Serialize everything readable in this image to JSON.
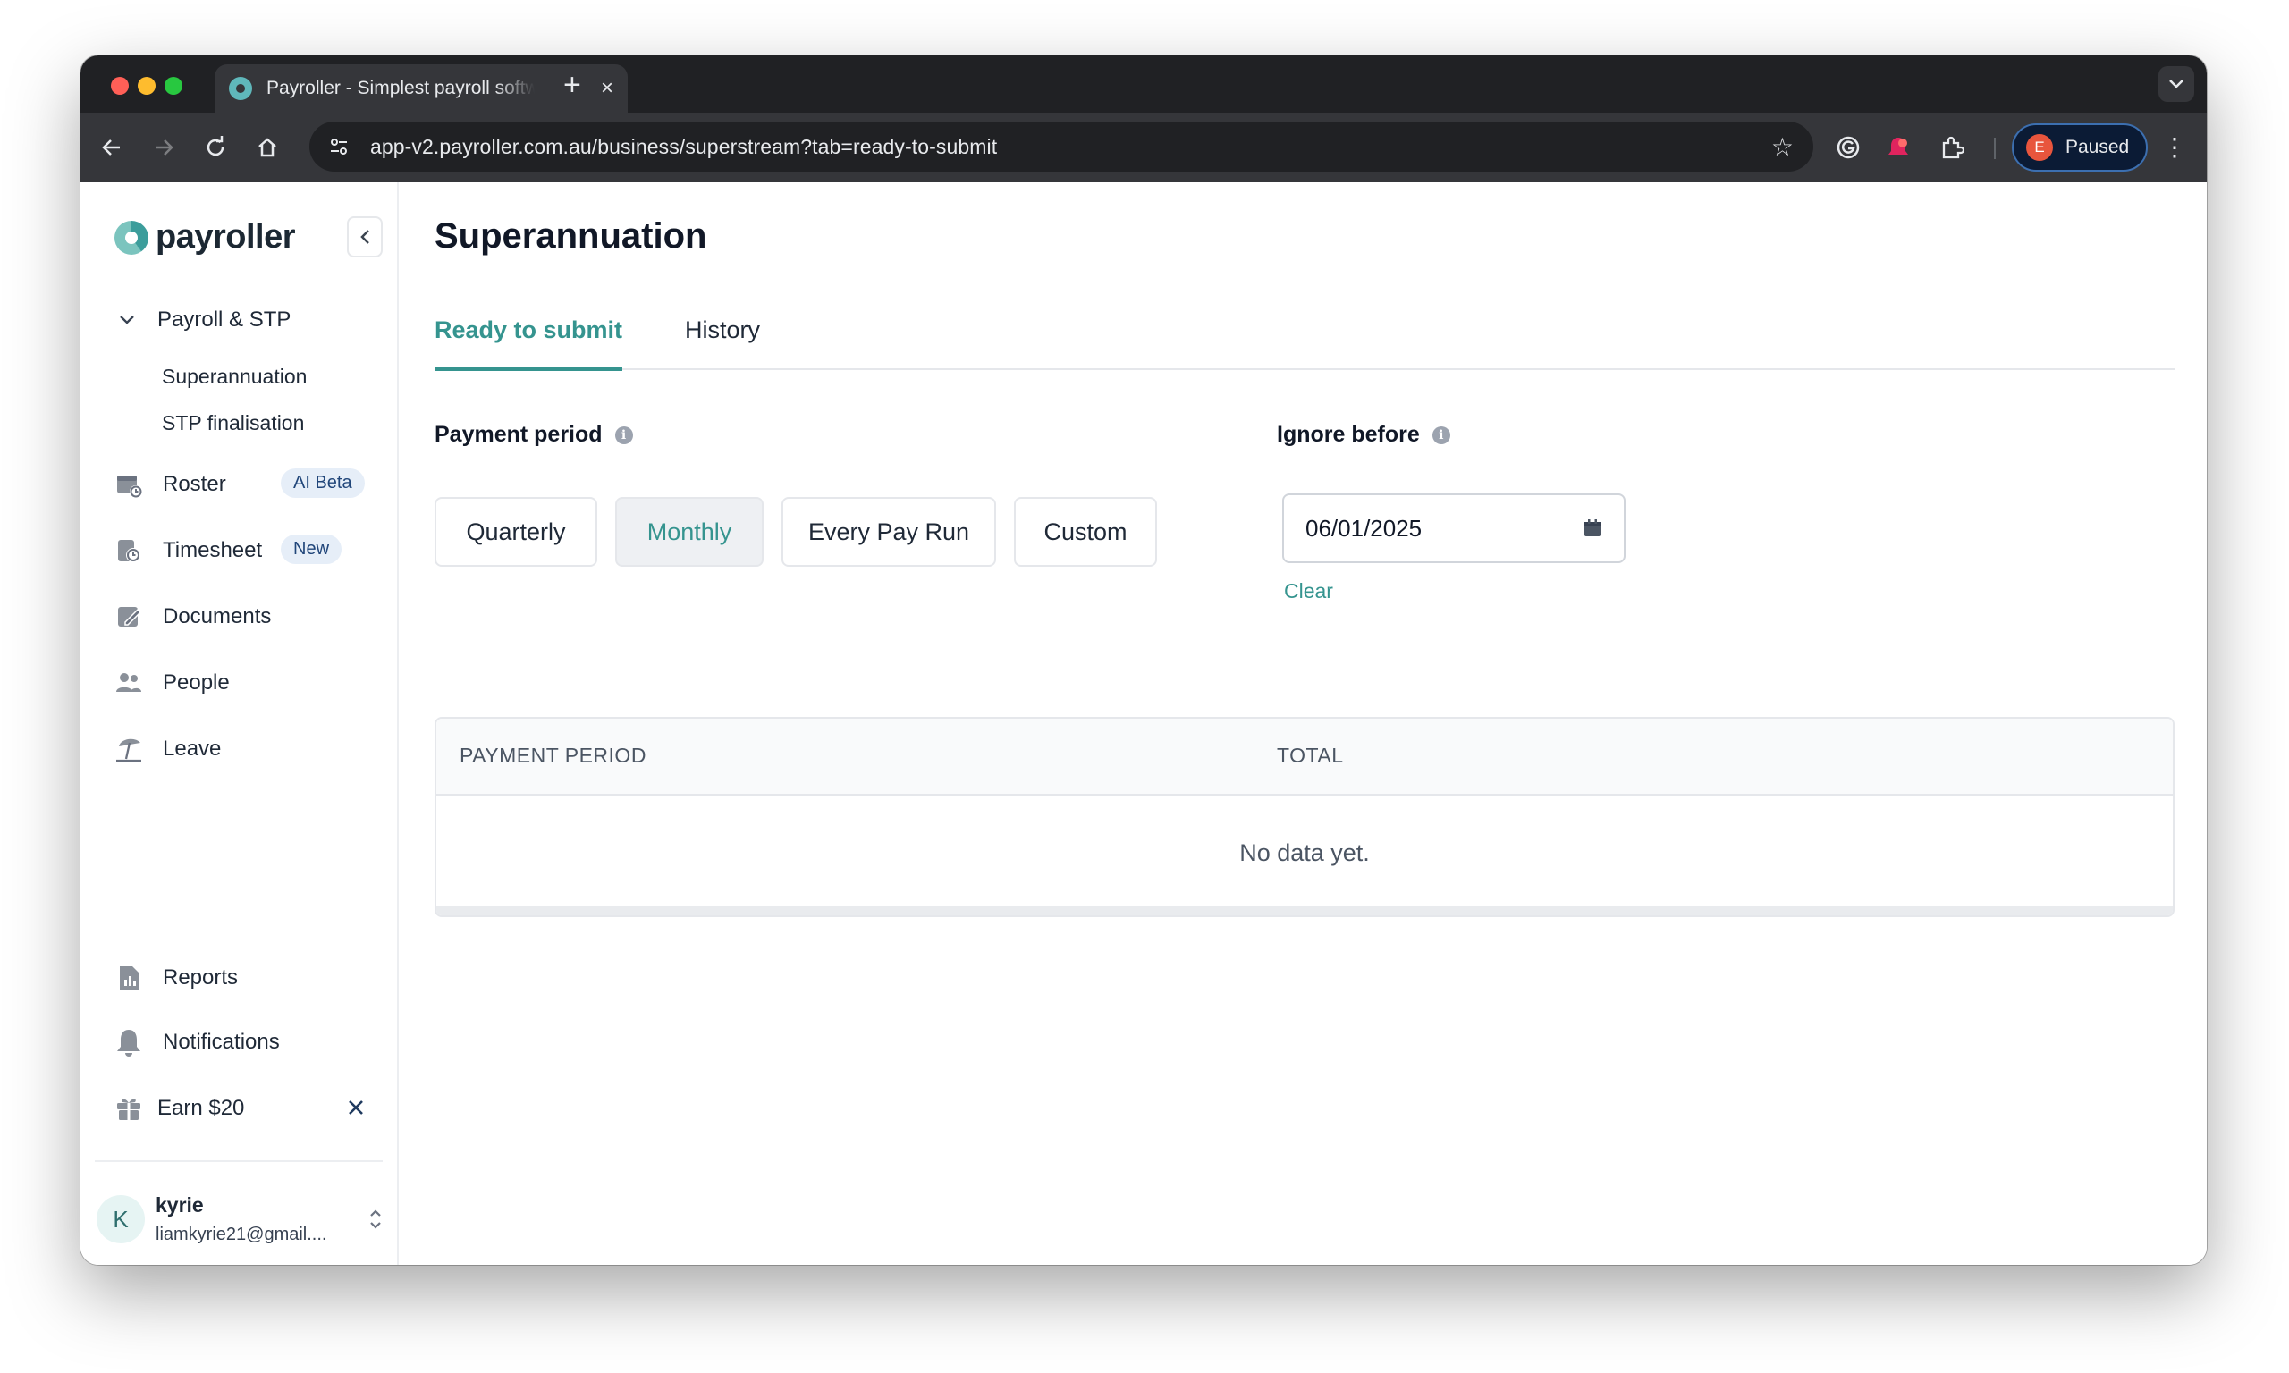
{
  "browser": {
    "tab_title": "Payroller - Simplest payroll software",
    "tab_close": "×",
    "new_tab": "+",
    "url": "app-v2.payroller.com.au/business/superstream?tab=ready-to-submit",
    "profile_initial": "E",
    "profile_label": "Paused"
  },
  "sidebar": {
    "logo_text": "payroller",
    "group": {
      "label": "Payroll & STP",
      "subitems": [
        "Superannuation",
        "STP finalisation"
      ]
    },
    "items": [
      {
        "label": "Roster",
        "icon": "roster-icon",
        "badge": "AI Beta"
      },
      {
        "label": "Timesheet",
        "icon": "timesheet-icon",
        "badge": "New"
      },
      {
        "label": "Documents",
        "icon": "documents-icon"
      },
      {
        "label": "People",
        "icon": "people-icon"
      },
      {
        "label": "Leave",
        "icon": "leave-icon"
      }
    ],
    "bottom_items": [
      {
        "label": "Reports",
        "icon": "reports-icon"
      },
      {
        "label": "Notifications",
        "icon": "bell-icon"
      },
      {
        "label": "Earn $20",
        "icon": "gift-icon"
      }
    ],
    "user": {
      "initial": "K",
      "name": "kyrie",
      "email": "liamkyrie21@gmail...."
    }
  },
  "main": {
    "title": "Superannuation",
    "tabs": [
      {
        "label": "Ready to submit",
        "active": true
      },
      {
        "label": "History",
        "active": false
      }
    ],
    "payment_period": {
      "label": "Payment period",
      "options": [
        "Quarterly",
        "Monthly",
        "Every Pay Run",
        "Custom"
      ],
      "selected": "Monthly"
    },
    "ignore_before": {
      "label": "Ignore before",
      "value": "06/01/2025",
      "clear_label": "Clear"
    },
    "table": {
      "columns": [
        "PAYMENT PERIOD",
        "TOTAL"
      ],
      "empty_text": "No data yet."
    }
  },
  "colors": {
    "accent": "#35948f",
    "badge_bg": "#e6eef8",
    "badge_text": "#21467a"
  }
}
